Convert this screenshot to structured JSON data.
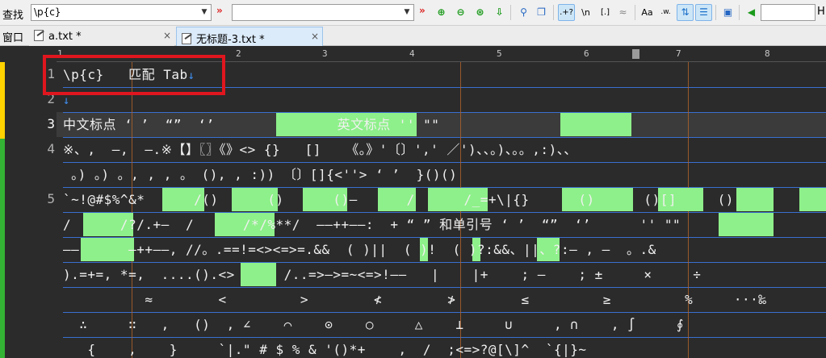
{
  "search": {
    "label": "查找",
    "find_value": "\\p{c}",
    "replace_value": "",
    "between_arrows": "»",
    "after_arrows": "»",
    "h_label": "H",
    "regex_label": ".+?",
    "newline_label": "\\n",
    "wordchar_label": "[.]",
    "approx_label": "≈",
    "case_label": "Aa",
    "word_label": ".w."
  },
  "tabs": {
    "window_label": "窗口",
    "items": [
      {
        "label": "a.txt *",
        "active": false
      },
      {
        "label": "无标题-3.txt *",
        "active": true
      }
    ],
    "close_glyph": "×"
  },
  "ruler": {
    "labels": [
      "1",
      "2",
      "3",
      "4",
      "5",
      "6",
      "7",
      "8"
    ]
  },
  "editor": {
    "line_numbers": [
      "1",
      "2",
      "3",
      "4",
      "",
      "5",
      "",
      "",
      "",
      "",
      "",
      ""
    ],
    "current_line": 3,
    "lines": [
      "\\p{c}   匹配 Tab",
      "",
      "中文标点 ‘ ’  “”  ‘’               英文标点 '' \"\"",
      "※、,  —,  —.※【】〖〗《》<> {}   []   《。》'〔〕',' ／')、、。)、。。,:)、、",
      " 。) 。) 。, , , 。 (), , :)) 〔〕[]{<''> ‘ ’  }()()",
      "`~!@#$%^&*      /()      ()      ()—      /      /_=+\\|{}      ()      ()[]     ()",
      "/      /?/.+—  /      /*/%**/  ——++——:  + “ ” 和单引号 ‘ ’  “”  ‘’      '' \"\"",
      "——      —++——, //。.==!=<><=>=.&&  ( )||  ( )!  ( )?:&&、||、?:— , —  。.&",
      ").=+=, *=,  ....().<>      /..=>—>=~<=>!——   |    |+    ; —    ; ±     ×     ÷",
      "          ≈        <         >        ≮        ≯        ≤         ≥         %     ···‰",
      "  ∴     ∷   ,   ()  , ∠    ⌒    ⊙    ○     △    ⊥     ∪     , ∩    , ∫     ∮",
      "   {    ,    }     `|.\" # $ % & '()*+    ,  /  ;<=>?@[\\]^  `{|}~"
    ],
    "crlf_glyph": "↓"
  }
}
